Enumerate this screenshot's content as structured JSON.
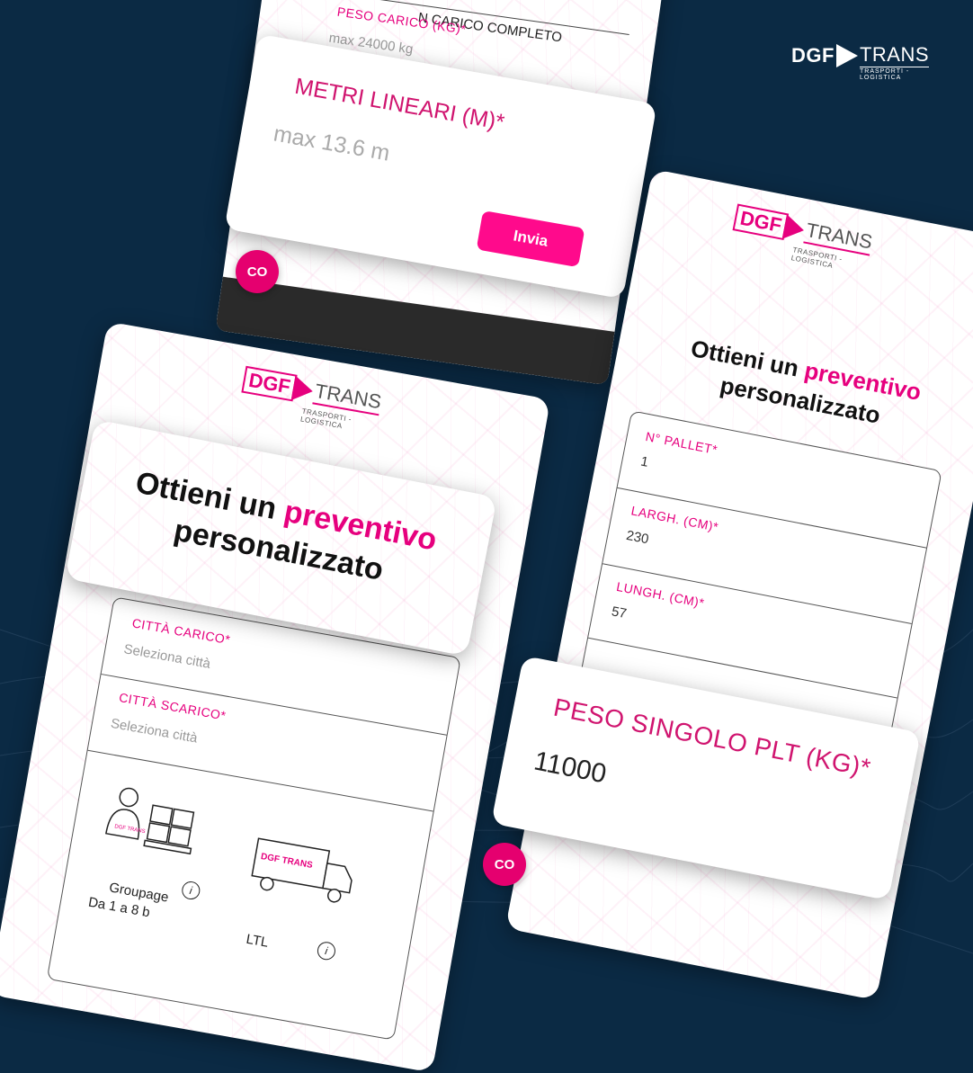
{
  "brand": {
    "left": "DGF",
    "right": "TRANS",
    "tagline": "TRASPORTI - LOGISTICA"
  },
  "card_top": {
    "header_fragment": "N CARICO COMPLETO",
    "peso_label": "PESO CARICO (KG)*",
    "peso_placeholder": "max 24000 kg",
    "metri_label": "METRI LINEARI (M)*",
    "metri_placeholder": "max 13.6 m",
    "submit_label": "Invia",
    "chat_label": "CO"
  },
  "card_left": {
    "logo_left": "DGF",
    "logo_right": "TRANS",
    "logo_sub": "TRASPORTI - LOGISTICA",
    "title_part1": "Ottieni un ",
    "title_highlight": "preventivo",
    "title_part2": "personalizzato",
    "citta_carico_label": "CITTÀ CARICO*",
    "citta_carico_placeholder": "Seleziona città",
    "citta_scarico_label": "CITTÀ SCARICO*",
    "citta_scarico_placeholder": "Seleziona città",
    "option1_title": "Groupage",
    "option1_sub": "Da 1 a 8 b",
    "option2_title": "LTL",
    "info_icon": "i"
  },
  "card_right": {
    "logo_left": "DGF",
    "logo_right": "TRANS",
    "logo_sub": "TRASPORTI - LOGISTICA",
    "title_part1": "Ottieni un ",
    "title_highlight": "preventivo",
    "title_part2": "personalizzato",
    "pallet_label": "N° PALLET*",
    "pallet_value": "1",
    "largh_label": "LARGH. (CM)*",
    "largh_value": "230",
    "lungh_label": "LUNGH. (CM)*",
    "lungh_value": "57",
    "peso_label": "PESO SINGOLO PLT (KG)*",
    "peso_value": "11000",
    "chat_label": "CO"
  }
}
